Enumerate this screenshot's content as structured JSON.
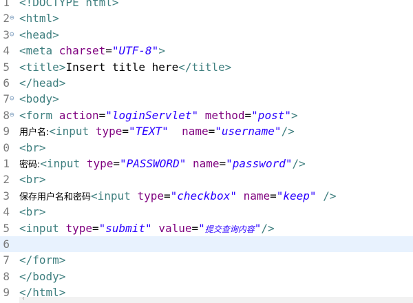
{
  "editor": {
    "lines": [
      {
        "num": "1",
        "fold": "",
        "parts": [
          {
            "t": "tag",
            "v": "<!DOCTYPE html>"
          }
        ]
      },
      {
        "num": "2",
        "fold": "⊖",
        "parts": [
          {
            "t": "tag",
            "v": "<html>"
          }
        ]
      },
      {
        "num": "3",
        "fold": "⊖",
        "parts": [
          {
            "t": "tag",
            "v": "<head>"
          }
        ]
      },
      {
        "num": "4",
        "fold": "",
        "parts": [
          {
            "t": "tag",
            "v": "<meta "
          },
          {
            "t": "attr",
            "v": "charset"
          },
          {
            "t": "txt",
            "v": "="
          },
          {
            "t": "val",
            "v": "\"UTF-8\""
          },
          {
            "t": "tag",
            "v": ">"
          }
        ]
      },
      {
        "num": "5",
        "fold": "",
        "parts": [
          {
            "t": "tag",
            "v": "<title>"
          },
          {
            "t": "txt",
            "v": "Insert title here"
          },
          {
            "t": "tag",
            "v": "</title>"
          }
        ]
      },
      {
        "num": "6",
        "fold": "",
        "parts": [
          {
            "t": "tag",
            "v": "</head>"
          }
        ]
      },
      {
        "num": "7",
        "fold": "⊖",
        "parts": [
          {
            "t": "tag",
            "v": "<body>"
          }
        ]
      },
      {
        "num": "8",
        "fold": "⊖",
        "parts": [
          {
            "t": "tag",
            "v": "<form "
          },
          {
            "t": "attr",
            "v": "action"
          },
          {
            "t": "txt",
            "v": "="
          },
          {
            "t": "val",
            "v": "\"loginServlet\""
          },
          {
            "t": "txt",
            "v": " "
          },
          {
            "t": "attr",
            "v": "method"
          },
          {
            "t": "txt",
            "v": "="
          },
          {
            "t": "val",
            "v": "\"post\""
          },
          {
            "t": "tag",
            "v": ">"
          }
        ]
      },
      {
        "num": "9",
        "fold": "",
        "parts": [
          {
            "t": "cn",
            "v": "用户名:"
          },
          {
            "t": "tag",
            "v": "<input "
          },
          {
            "t": "attr",
            "v": "type"
          },
          {
            "t": "txt",
            "v": "="
          },
          {
            "t": "val",
            "v": "\"TEXT\""
          },
          {
            "t": "txt",
            "v": "  "
          },
          {
            "t": "attr",
            "v": "name"
          },
          {
            "t": "txt",
            "v": "="
          },
          {
            "t": "val",
            "v": "\"username\""
          },
          {
            "t": "tag",
            "v": "/>"
          }
        ]
      },
      {
        "num": "0",
        "fold": "",
        "parts": [
          {
            "t": "tag",
            "v": "<br>"
          }
        ]
      },
      {
        "num": "1",
        "fold": "",
        "parts": [
          {
            "t": "cn",
            "v": "密码:"
          },
          {
            "t": "tag",
            "v": "<input "
          },
          {
            "t": "attr",
            "v": "type"
          },
          {
            "t": "txt",
            "v": "="
          },
          {
            "t": "val",
            "v": "\"PASSWORD\""
          },
          {
            "t": "txt",
            "v": " "
          },
          {
            "t": "attr",
            "v": "name"
          },
          {
            "t": "txt",
            "v": "="
          },
          {
            "t": "val",
            "v": "\"password\""
          },
          {
            "t": "tag",
            "v": "/>"
          }
        ]
      },
      {
        "num": "2",
        "fold": "",
        "parts": [
          {
            "t": "tag",
            "v": "<br>"
          }
        ]
      },
      {
        "num": "3",
        "fold": "",
        "parts": [
          {
            "t": "cn",
            "v": "保存用户名和密码"
          },
          {
            "t": "tag",
            "v": "<input "
          },
          {
            "t": "attr",
            "v": "type"
          },
          {
            "t": "txt",
            "v": "="
          },
          {
            "t": "val",
            "v": "\"checkbox\""
          },
          {
            "t": "txt",
            "v": " "
          },
          {
            "t": "attr",
            "v": "name"
          },
          {
            "t": "txt",
            "v": "="
          },
          {
            "t": "val",
            "v": "\"keep\""
          },
          {
            "t": "txt",
            "v": " "
          },
          {
            "t": "tag",
            "v": "/>"
          }
        ]
      },
      {
        "num": "4",
        "fold": "",
        "parts": [
          {
            "t": "tag",
            "v": "<br>"
          }
        ]
      },
      {
        "num": "5",
        "fold": "",
        "parts": [
          {
            "t": "tag",
            "v": "<input "
          },
          {
            "t": "attr",
            "v": "type"
          },
          {
            "t": "txt",
            "v": "="
          },
          {
            "t": "val",
            "v": "\"submit\""
          },
          {
            "t": "txt",
            "v": " "
          },
          {
            "t": "attr",
            "v": "value"
          },
          {
            "t": "txt",
            "v": "="
          },
          {
            "t": "val",
            "v": "\""
          },
          {
            "t": "cnval",
            "v": "提交查询内容"
          },
          {
            "t": "val",
            "v": "\""
          },
          {
            "t": "tag",
            "v": "/>"
          }
        ]
      },
      {
        "num": "6",
        "fold": "",
        "current": true,
        "parts": []
      },
      {
        "num": "7",
        "fold": "",
        "parts": [
          {
            "t": "tag",
            "v": "</form>"
          }
        ]
      },
      {
        "num": "8",
        "fold": "",
        "parts": [
          {
            "t": "tag",
            "v": "</body>"
          }
        ]
      },
      {
        "num": "9",
        "fold": "",
        "parts": [
          {
            "t": "tag",
            "v": "</html>"
          }
        ]
      }
    ]
  },
  "scrollbar": {
    "arrow_icon": "scroll-left-icon",
    "glyph": "‹"
  },
  "colors": {
    "tag": "#3f7f7f",
    "attribute": "#7f007f",
    "value": "#2a00ff",
    "current_line": "#e8f2fe",
    "line_numbers": "#7a7a7a"
  }
}
